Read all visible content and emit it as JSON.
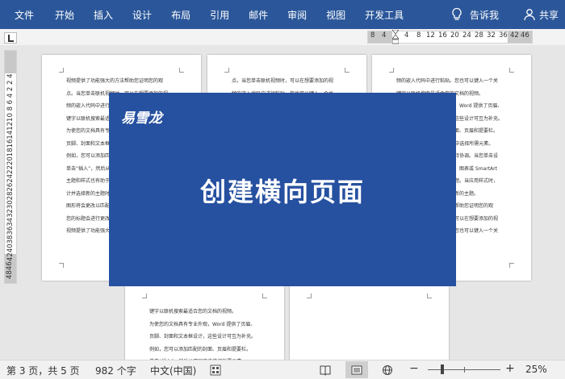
{
  "menu": {
    "tabs": [
      "文件",
      "开始",
      "插入",
      "设计",
      "布局",
      "引用",
      "邮件",
      "审阅",
      "视图",
      "开发工具"
    ],
    "tell_me": "告诉我",
    "share": "共享"
  },
  "ruler": {
    "h_ticks": [
      "8",
      "4",
      "4",
      "8",
      "12",
      "16",
      "20",
      "24",
      "28",
      "32",
      "36",
      "42",
      "46"
    ],
    "v_text": "4240383634323028262422201816141210 8 6 4 2 2 4",
    "v_bottom": "4846"
  },
  "pages": {
    "page1": [
      "视频提供了功能强大的方法帮助您证明您的观",
      "点。当您单击联机视频时，可以在想要添加的视",
      "频的嵌入代码中进行粘贴。您也可以键入一个关",
      "键字以联机搜索最适合您的文档的视频。",
      "为使您的文档具有专业外观，Word 提供了页眉、",
      "页脚、封面和文本框设计，这些设计可互为补充。",
      "例如，您可以添加匹配的封面、页眉和提要栏。",
      "单击“插入”，然后从不同库中选择所需元素。",
      "主题和样式也有助于文档保持协调。当您单击设",
      "计并选择新的主题时，图片、图表或 SmartArt",
      "图形将会更改以匹配新的主题。当应用样式时，",
      "您的标题会进行更改以匹配新的主题。",
      "视频提供了功能强大的方法帮助您证明您的观"
    ],
    "page2": [
      "点。当您单击联机视频时，可以在想要添加的视",
      "频的嵌入代码中进行粘贴。您也可以键入一个关"
    ],
    "page3": [
      "频的嵌入代码中进行粘贴。您也可以键入一个关",
      "键字以联机搜索最适合您的文档的视频。",
      "为使您的文档具有专业外观，Word 提供了页眉、",
      "页脚、封面和文本框设计，这些设计可互为补充。",
      "例如，您可以添加匹配的封面、页眉和提要栏。",
      "单击“插入”，然后从不同库中选择所需元素。",
      "主题和样式也有助于文档保持协调。当您单击设",
      "计并选择新的主题时，图片、图表或 SmartArt",
      "图形将会更改以匹配新的主题。当应用样式时，",
      "您的标题会进行更改以匹配新的主题。",
      "视频提供了功能强大的方法帮助您证明您的观",
      "点。当您单击联机视频时，可以在想要添加的视",
      "频的嵌入代码中进行粘贴。您也可以键入一个关"
    ],
    "page4": [
      "键字以联机搜索最适合您的文档的视频。",
      "为使您的文档具有专业外观，Word 提供了页眉、",
      "页脚、封面和文本框设计，这些设计可互为补充。",
      "例如，您可以添加匹配的封面、页眉和提要栏。",
      "单击“插入”，然后从不同库中选择所需元素。"
    ]
  },
  "banner": {
    "brand": "易雪龙",
    "headline": "创建横向页面",
    "color": "#2650a0"
  },
  "status": {
    "page": "第 3 页，共 5 页",
    "words": "982 个字",
    "language": "中文(中国)",
    "zoom": "25%",
    "minus": "−",
    "plus": "+"
  }
}
